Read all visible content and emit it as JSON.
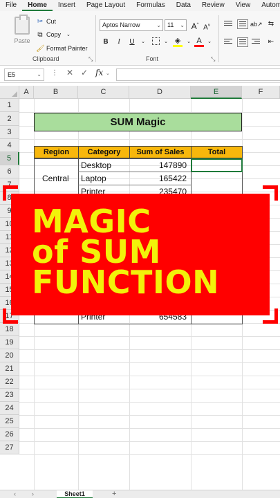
{
  "menu": {
    "tabs": [
      "File",
      "Home",
      "Insert",
      "Page Layout",
      "Formulas",
      "Data",
      "Review",
      "View",
      "Autom"
    ],
    "active": "Home"
  },
  "ribbon": {
    "clipboard": {
      "paste_label": "Paste",
      "cut_label": "Cut",
      "copy_label": "Copy",
      "format_painter_label": "Format Painter",
      "group_label": "Clipboard"
    },
    "font": {
      "font_name": "Aptos Narrow",
      "font_size": "11",
      "bold": "B",
      "italic": "I",
      "underline": "U",
      "grow": "A",
      "shrink": "A",
      "font_color_letter": "A",
      "group_label": "Font",
      "highlight_color": "#ffff00",
      "font_color": "#ff0000"
    }
  },
  "formula_bar": {
    "name_box": "E5",
    "fx_label": "fx",
    "value": ""
  },
  "grid": {
    "columns": [
      "A",
      "B",
      "C",
      "D",
      "E",
      "F"
    ],
    "selected_column": "E",
    "rows": [
      "1",
      "2",
      "3",
      "4",
      "5",
      "6",
      "7",
      "8",
      "9",
      "10",
      "11",
      "12",
      "13",
      "14",
      "15",
      "16",
      "17",
      "18",
      "19",
      "20",
      "21",
      "22",
      "23",
      "24",
      "25",
      "26",
      "27"
    ],
    "selected_row": "5",
    "title": "SUM Magic",
    "headers": [
      "Region",
      "Category",
      "Sum of Sales",
      "Total"
    ],
    "region": "Central",
    "data_rows": [
      {
        "category": "Desktop",
        "sales": "147890"
      },
      {
        "category": "Laptop",
        "sales": "165422"
      },
      {
        "category": "Printer",
        "sales": "235470"
      }
    ],
    "partial_row": {
      "category": "Printer",
      "sales": "654583"
    },
    "accent_title_fill": "#a9dd9c",
    "accent_header_fill": "#f8b70c"
  },
  "overlay": {
    "line1": "MAGIC",
    "line2": "of SUM",
    "line3": "FUNCTION",
    "background": "#ff0000",
    "text_color": "#f2f20a"
  },
  "sheets": {
    "tabs": [
      "Sheet1"
    ],
    "add_label": "+"
  }
}
